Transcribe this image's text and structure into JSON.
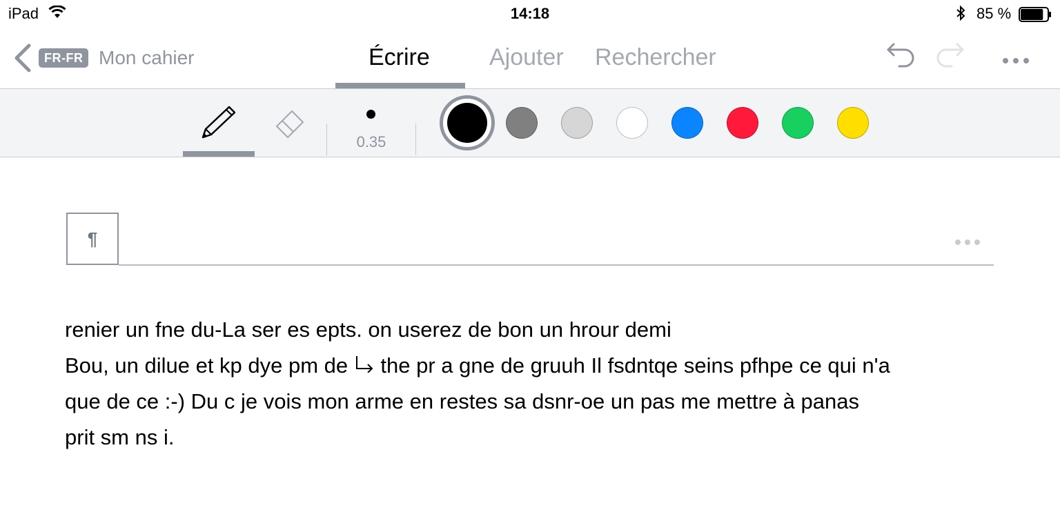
{
  "status_bar": {
    "device": "iPad",
    "time": "14:18",
    "battery_percent": "85 %",
    "battery_level": 0.85
  },
  "nav": {
    "language": "FR-FR",
    "notebook": "Mon cahier",
    "tabs": [
      {
        "label": "Écrire",
        "active": true
      },
      {
        "label": "Ajouter",
        "active": false
      },
      {
        "label": "Rechercher",
        "active": false
      }
    ]
  },
  "toolbar": {
    "pen_size": "0.35",
    "colors": [
      "#000000",
      "#808080",
      "#d6d6d6",
      "#ffffff",
      "#0a84ff",
      "#ff1a3c",
      "#17d060",
      "#ffde00"
    ],
    "selected_color": "#000000"
  },
  "document": {
    "lines": [
      "renier un fne du-La ser es epts. on userez de bon un hrour demi",
      "Bou, un dilue et kp dye pm de",
      "the pr a gne de gruuh Il fsdntqe seins pfhpe ce qui n'a",
      "que de ce :-) Du c je vois mon arme en restes sa dsnr-oe un pas me mettre à panas",
      "prit sm ns i."
    ]
  },
  "accent_color": "#8e959e"
}
